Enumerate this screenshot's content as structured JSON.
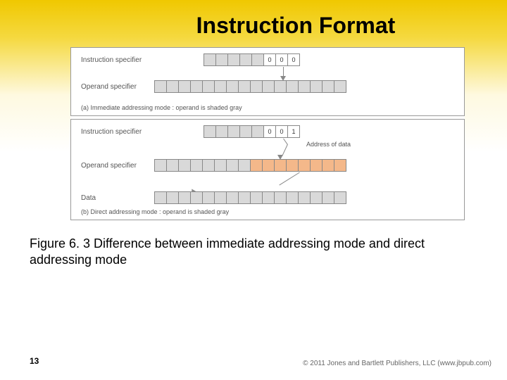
{
  "title": "Instruction Format",
  "panelA": {
    "row1_label": "Instruction specifier",
    "row1_bits": [
      "",
      "",
      "",
      "",
      "",
      "0",
      "0",
      "0"
    ],
    "row2_label": "Operand specifier",
    "caption": "(a) Immediate addressing mode : operand is shaded gray"
  },
  "panelB": {
    "row1_label": "Instruction specifier",
    "row1_bits": [
      "",
      "",
      "",
      "",
      "",
      "0",
      "0",
      "1"
    ],
    "addr_label": "Address of data",
    "row2_label": "Operand specifier",
    "row3_label": "Data",
    "caption": "(b) Direct addressing mode : operand is shaded gray"
  },
  "figure_caption": "Figure 6. 3 Difference between immediate addressing mode and direct addressing mode",
  "page_number": "13",
  "copyright": "© 2011 Jones and Bartlett Publishers, LLC (www.jbpub.com)"
}
